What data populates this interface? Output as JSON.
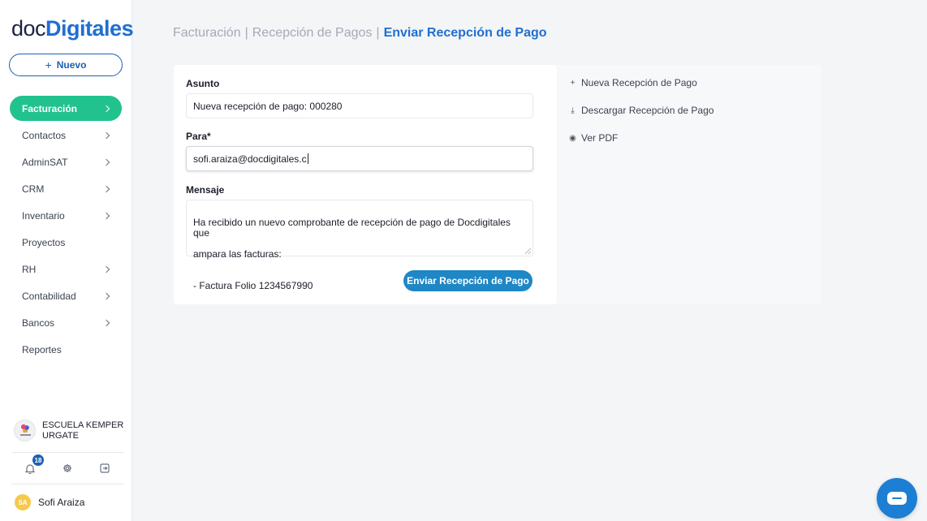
{
  "logo": {
    "part1": "doc",
    "part2": "Digitales"
  },
  "sidebar": {
    "new_button": {
      "icon": "plus-icon",
      "label": "Nuevo"
    },
    "items": [
      {
        "label": "Facturación",
        "active": true,
        "has_chevron": true
      },
      {
        "label": "Contactos",
        "has_chevron": true
      },
      {
        "label": "AdminSAT",
        "has_chevron": true
      },
      {
        "label": "CRM",
        "has_chevron": true
      },
      {
        "label": "Inventario",
        "has_chevron": true
      },
      {
        "label": "Proyectos",
        "has_chevron": false
      },
      {
        "label": "RH",
        "has_chevron": true
      },
      {
        "label": "Contabilidad",
        "has_chevron": true
      },
      {
        "label": "Bancos",
        "has_chevron": true
      },
      {
        "label": "Reportes",
        "has_chevron": false
      }
    ],
    "organization": {
      "name": "ESCUELA KEMPER URGATE"
    },
    "utilities": {
      "notifications_count": "18"
    },
    "user": {
      "initials": "SA",
      "name": "Sofi Araiza"
    }
  },
  "breadcrumb": {
    "items": [
      "Facturación",
      "Recepción de Pagos"
    ],
    "separator": "|",
    "current": "Enviar Recepción de Pago"
  },
  "form": {
    "subject": {
      "label": "Asunto",
      "value": "Nueva recepción de pago: 000280"
    },
    "to": {
      "label": "Para*",
      "value": "sofi.araiza@docdigitales.c"
    },
    "message": {
      "label": "Mensaje",
      "line1": "Ha recibido un nuevo comprobante de recepción de pago de Docdigitales que",
      "line2": "ampara las facturas:",
      "line3": "- Factura Folio 1234567990"
    },
    "submit_label": "Enviar Recepción de Pago"
  },
  "actions": [
    {
      "icon": "plus-icon",
      "glyph": "+",
      "label": "Nueva Recepción de Pago"
    },
    {
      "icon": "download-icon",
      "glyph": "⤓",
      "label": "Descargar Recepción de Pago"
    },
    {
      "icon": "eye-icon",
      "glyph": "◉",
      "label": "Ver PDF"
    }
  ],
  "colors": {
    "accent_blue": "#1f6fd1",
    "active_green": "#21c28e",
    "button_blue": "#1f87c5"
  }
}
